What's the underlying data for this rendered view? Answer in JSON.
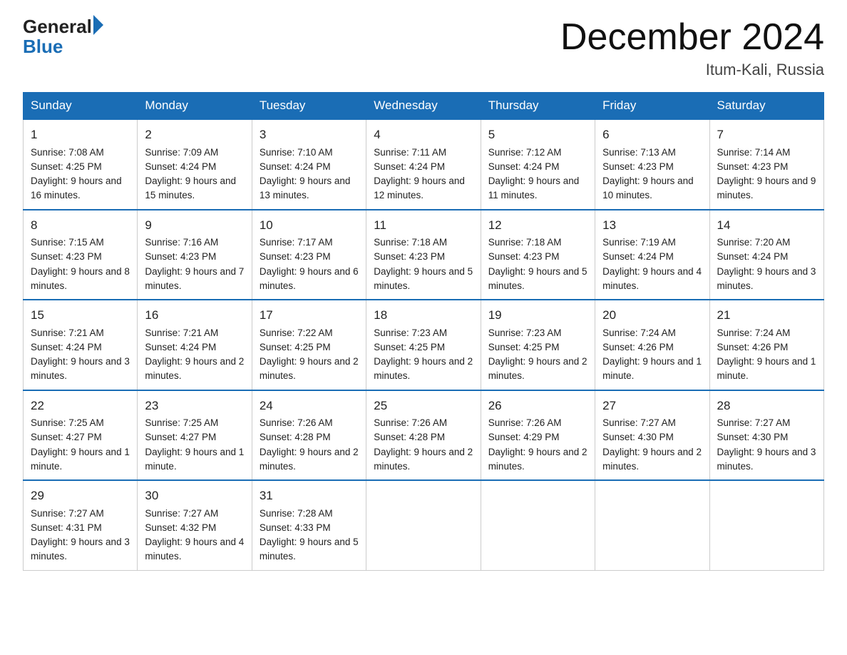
{
  "logo": {
    "general": "General",
    "blue": "Blue",
    "arrow": "▶"
  },
  "title": "December 2024",
  "location": "Itum-Kali, Russia",
  "days": [
    "Sunday",
    "Monday",
    "Tuesday",
    "Wednesday",
    "Thursday",
    "Friday",
    "Saturday"
  ],
  "weeks": [
    [
      {
        "num": "1",
        "sunrise": "7:08 AM",
        "sunset": "4:25 PM",
        "daylight": "9 hours and 16 minutes."
      },
      {
        "num": "2",
        "sunrise": "7:09 AM",
        "sunset": "4:24 PM",
        "daylight": "9 hours and 15 minutes."
      },
      {
        "num": "3",
        "sunrise": "7:10 AM",
        "sunset": "4:24 PM",
        "daylight": "9 hours and 13 minutes."
      },
      {
        "num": "4",
        "sunrise": "7:11 AM",
        "sunset": "4:24 PM",
        "daylight": "9 hours and 12 minutes."
      },
      {
        "num": "5",
        "sunrise": "7:12 AM",
        "sunset": "4:24 PM",
        "daylight": "9 hours and 11 minutes."
      },
      {
        "num": "6",
        "sunrise": "7:13 AM",
        "sunset": "4:23 PM",
        "daylight": "9 hours and 10 minutes."
      },
      {
        "num": "7",
        "sunrise": "7:14 AM",
        "sunset": "4:23 PM",
        "daylight": "9 hours and 9 minutes."
      }
    ],
    [
      {
        "num": "8",
        "sunrise": "7:15 AM",
        "sunset": "4:23 PM",
        "daylight": "9 hours and 8 minutes."
      },
      {
        "num": "9",
        "sunrise": "7:16 AM",
        "sunset": "4:23 PM",
        "daylight": "9 hours and 7 minutes."
      },
      {
        "num": "10",
        "sunrise": "7:17 AM",
        "sunset": "4:23 PM",
        "daylight": "9 hours and 6 minutes."
      },
      {
        "num": "11",
        "sunrise": "7:18 AM",
        "sunset": "4:23 PM",
        "daylight": "9 hours and 5 minutes."
      },
      {
        "num": "12",
        "sunrise": "7:18 AM",
        "sunset": "4:23 PM",
        "daylight": "9 hours and 5 minutes."
      },
      {
        "num": "13",
        "sunrise": "7:19 AM",
        "sunset": "4:24 PM",
        "daylight": "9 hours and 4 minutes."
      },
      {
        "num": "14",
        "sunrise": "7:20 AM",
        "sunset": "4:24 PM",
        "daylight": "9 hours and 3 minutes."
      }
    ],
    [
      {
        "num": "15",
        "sunrise": "7:21 AM",
        "sunset": "4:24 PM",
        "daylight": "9 hours and 3 minutes."
      },
      {
        "num": "16",
        "sunrise": "7:21 AM",
        "sunset": "4:24 PM",
        "daylight": "9 hours and 2 minutes."
      },
      {
        "num": "17",
        "sunrise": "7:22 AM",
        "sunset": "4:25 PM",
        "daylight": "9 hours and 2 minutes."
      },
      {
        "num": "18",
        "sunrise": "7:23 AM",
        "sunset": "4:25 PM",
        "daylight": "9 hours and 2 minutes."
      },
      {
        "num": "19",
        "sunrise": "7:23 AM",
        "sunset": "4:25 PM",
        "daylight": "9 hours and 2 minutes."
      },
      {
        "num": "20",
        "sunrise": "7:24 AM",
        "sunset": "4:26 PM",
        "daylight": "9 hours and 1 minute."
      },
      {
        "num": "21",
        "sunrise": "7:24 AM",
        "sunset": "4:26 PM",
        "daylight": "9 hours and 1 minute."
      }
    ],
    [
      {
        "num": "22",
        "sunrise": "7:25 AM",
        "sunset": "4:27 PM",
        "daylight": "9 hours and 1 minute."
      },
      {
        "num": "23",
        "sunrise": "7:25 AM",
        "sunset": "4:27 PM",
        "daylight": "9 hours and 1 minute."
      },
      {
        "num": "24",
        "sunrise": "7:26 AM",
        "sunset": "4:28 PM",
        "daylight": "9 hours and 2 minutes."
      },
      {
        "num": "25",
        "sunrise": "7:26 AM",
        "sunset": "4:28 PM",
        "daylight": "9 hours and 2 minutes."
      },
      {
        "num": "26",
        "sunrise": "7:26 AM",
        "sunset": "4:29 PM",
        "daylight": "9 hours and 2 minutes."
      },
      {
        "num": "27",
        "sunrise": "7:27 AM",
        "sunset": "4:30 PM",
        "daylight": "9 hours and 2 minutes."
      },
      {
        "num": "28",
        "sunrise": "7:27 AM",
        "sunset": "4:30 PM",
        "daylight": "9 hours and 3 minutes."
      }
    ],
    [
      {
        "num": "29",
        "sunrise": "7:27 AM",
        "sunset": "4:31 PM",
        "daylight": "9 hours and 3 minutes."
      },
      {
        "num": "30",
        "sunrise": "7:27 AM",
        "sunset": "4:32 PM",
        "daylight": "9 hours and 4 minutes."
      },
      {
        "num": "31",
        "sunrise": "7:28 AM",
        "sunset": "4:33 PM",
        "daylight": "9 hours and 5 minutes."
      },
      null,
      null,
      null,
      null
    ]
  ]
}
